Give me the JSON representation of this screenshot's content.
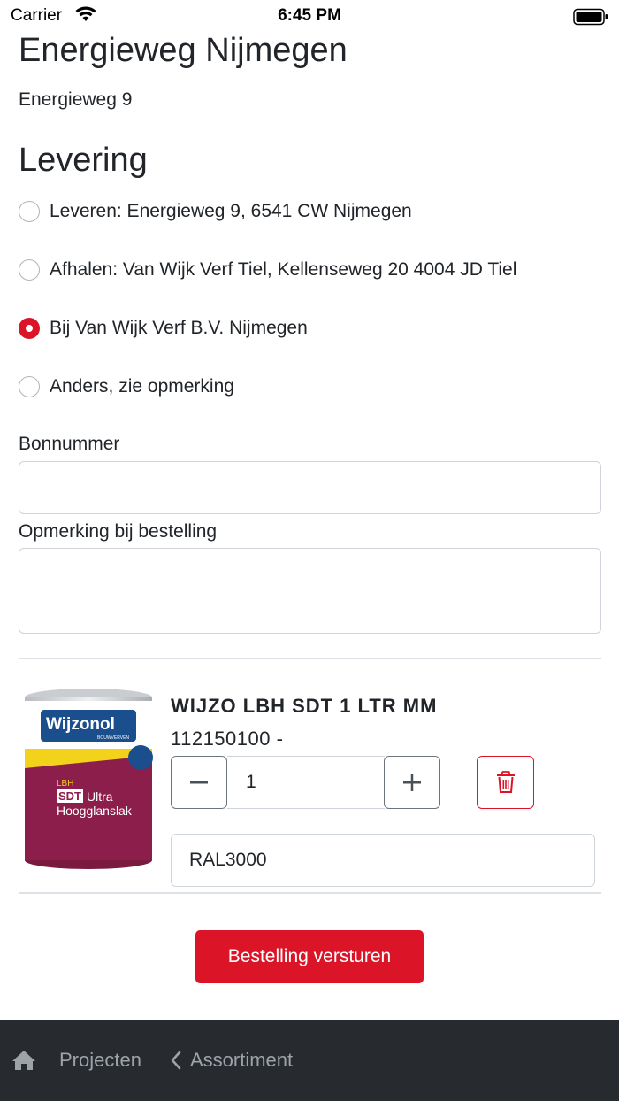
{
  "status_bar": {
    "carrier": "Carrier",
    "time": "6:45 PM"
  },
  "project": {
    "title": "Energieweg Nijmegen",
    "address": "Energieweg 9"
  },
  "delivery": {
    "title": "Levering",
    "options": [
      {
        "label": "Leveren: Energieweg 9, 6541 CW Nijmegen",
        "checked": false
      },
      {
        "label": "Afhalen: Van Wijk Verf Tiel, Kellenseweg 20 4004 JD Tiel",
        "checked": false
      },
      {
        "label": "Bij Van Wijk Verf B.V. Nijmegen",
        "checked": true
      },
      {
        "label": "Anders, zie opmerking",
        "checked": false
      }
    ]
  },
  "form": {
    "bonnummer_label": "Bonnummer",
    "bonnummer_value": "",
    "opmerking_label": "Opmerking bij bestelling",
    "opmerking_value": ""
  },
  "product": {
    "name": "WIJZO LBH SDT 1 LTR MM",
    "code": "112150100 -",
    "quantity": "1",
    "color": "RAL3000",
    "image_brand": "Wijzonol",
    "image_brand_sub": "BOUWVERVEN",
    "image_line1": "LBH",
    "image_line2": "SDT",
    "image_line3": "Ultra",
    "image_line4": "Hoogglanslak"
  },
  "actions": {
    "submit_label": "Bestelling versturen"
  },
  "bottom_nav": {
    "projecten_label": "Projecten",
    "assortiment_label": "Assortiment"
  },
  "colors": {
    "accent": "#dc1428",
    "nav_bg": "#272b30",
    "nav_text": "#9ea3a8"
  }
}
